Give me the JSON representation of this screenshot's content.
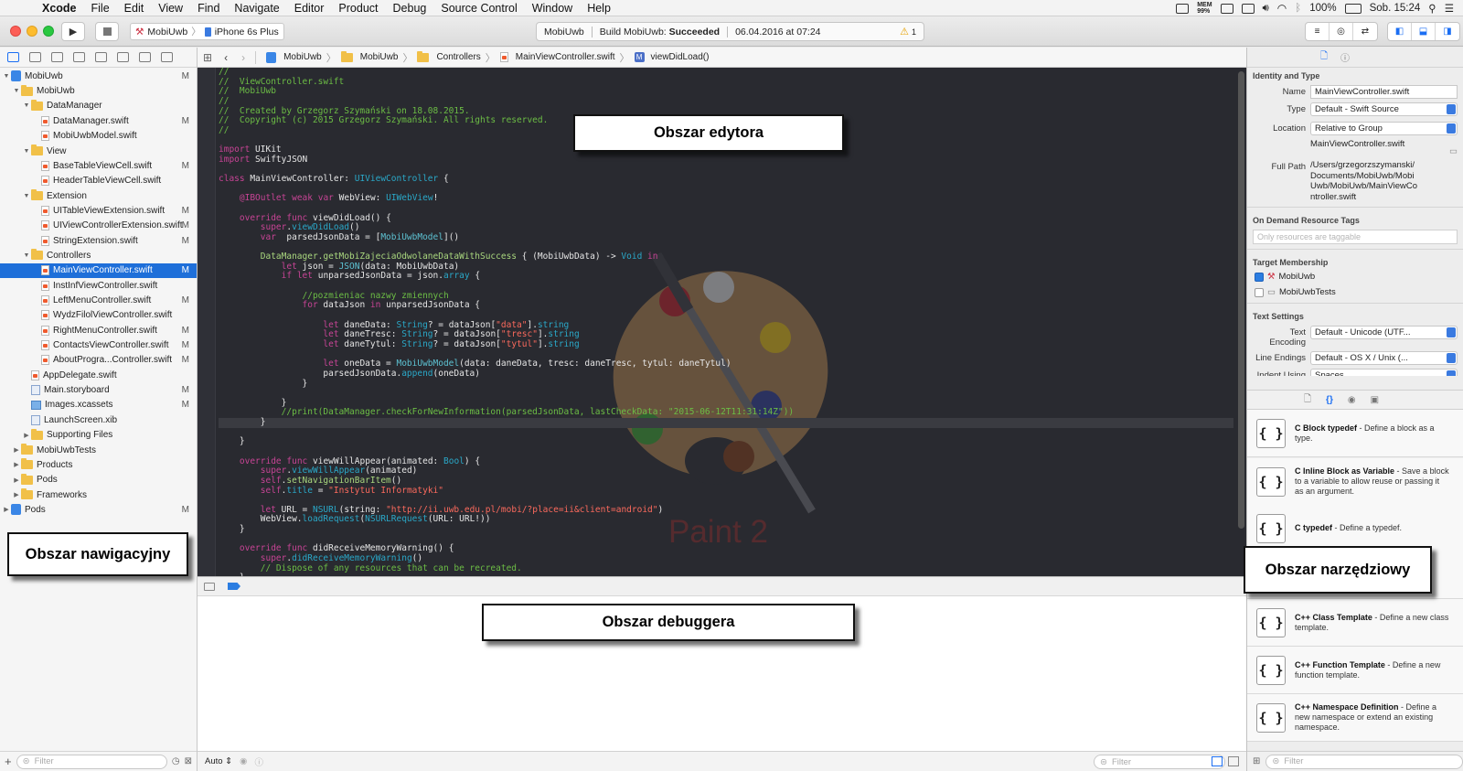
{
  "menubar": {
    "app": "Xcode",
    "items": [
      "File",
      "Edit",
      "View",
      "Find",
      "Navigate",
      "Editor",
      "Product",
      "Debug",
      "Source Control",
      "Window",
      "Help"
    ],
    "status": {
      "mem": "MEM\n99%",
      "battery": "100%",
      "clock": "Sob. 15:24"
    }
  },
  "toolbar": {
    "scheme": "MobiUwb",
    "device": "iPhone 6s Plus",
    "activity": {
      "project": "MobiUwb",
      "build_prefix": "Build MobiUwb: ",
      "build_status": "Succeeded",
      "datetime": "06.04.2016 at 07:24",
      "warnings": "1"
    }
  },
  "navigator": {
    "rows": [
      {
        "label": "MobiUwb",
        "indent": 0,
        "disc": "▼",
        "icon": "proj",
        "mark": "M"
      },
      {
        "label": "MobiUwb",
        "indent": 1,
        "disc": "▼",
        "icon": "fold",
        "mark": ""
      },
      {
        "label": "DataManager",
        "indent": 2,
        "disc": "▼",
        "icon": "fold",
        "mark": ""
      },
      {
        "label": "DataManager.swift",
        "indent": 3,
        "disc": "",
        "icon": "swf",
        "mark": "M"
      },
      {
        "label": "MobiUwbModel.swift",
        "indent": 3,
        "disc": "",
        "icon": "swf",
        "mark": ""
      },
      {
        "label": "View",
        "indent": 2,
        "disc": "▼",
        "icon": "fold",
        "mark": ""
      },
      {
        "label": "BaseTableViewCell.swift",
        "indent": 3,
        "disc": "",
        "icon": "swf",
        "mark": "M"
      },
      {
        "label": "HeaderTableViewCell.swift",
        "indent": 3,
        "disc": "",
        "icon": "swf",
        "mark": ""
      },
      {
        "label": "Extension",
        "indent": 2,
        "disc": "▼",
        "icon": "fold",
        "mark": ""
      },
      {
        "label": "UITableViewExtension.swift",
        "indent": 3,
        "disc": "",
        "icon": "swf",
        "mark": "M"
      },
      {
        "label": "UIViewControllerExtension.swift",
        "indent": 3,
        "disc": "",
        "icon": "swf",
        "mark": "M"
      },
      {
        "label": "StringExtension.swift",
        "indent": 3,
        "disc": "",
        "icon": "swf",
        "mark": "M"
      },
      {
        "label": "Controllers",
        "indent": 2,
        "disc": "▼",
        "icon": "fold",
        "mark": ""
      },
      {
        "label": "MainViewController.swift",
        "indent": 3,
        "disc": "",
        "icon": "swf",
        "mark": "M",
        "selected": true
      },
      {
        "label": "InstInfViewController.swift",
        "indent": 3,
        "disc": "",
        "icon": "swf",
        "mark": ""
      },
      {
        "label": "LeftMenuController.swift",
        "indent": 3,
        "disc": "",
        "icon": "swf",
        "mark": "M"
      },
      {
        "label": "WydzFilolViewController.swift",
        "indent": 3,
        "disc": "",
        "icon": "swf",
        "mark": ""
      },
      {
        "label": "RightMenuController.swift",
        "indent": 3,
        "disc": "",
        "icon": "swf",
        "mark": "M"
      },
      {
        "label": "ContactsViewController.swift",
        "indent": 3,
        "disc": "",
        "icon": "swf",
        "mark": "M"
      },
      {
        "label": "AboutProgra...Controller.swift",
        "indent": 3,
        "disc": "",
        "icon": "swf",
        "mark": "M"
      },
      {
        "label": "AppDelegate.swift",
        "indent": 2,
        "disc": "",
        "icon": "swf",
        "mark": ""
      },
      {
        "label": "Main.storyboard",
        "indent": 2,
        "disc": "",
        "icon": "xib",
        "mark": "M"
      },
      {
        "label": "Images.xcassets",
        "indent": 2,
        "disc": "",
        "icon": "asset",
        "mark": "M"
      },
      {
        "label": "LaunchScreen.xib",
        "indent": 2,
        "disc": "",
        "icon": "xib",
        "mark": ""
      },
      {
        "label": "Supporting Files",
        "indent": 2,
        "disc": "▶",
        "icon": "fold",
        "mark": ""
      },
      {
        "label": "MobiUwbTests",
        "indent": 1,
        "disc": "▶",
        "icon": "fold",
        "mark": ""
      },
      {
        "label": "Products",
        "indent": 1,
        "disc": "▶",
        "icon": "fold",
        "mark": ""
      },
      {
        "label": "Pods",
        "indent": 1,
        "disc": "▶",
        "icon": "fold",
        "mark": ""
      },
      {
        "label": "Frameworks",
        "indent": 1,
        "disc": "▶",
        "icon": "fold",
        "mark": ""
      },
      {
        "label": "Pods",
        "indent": 0,
        "disc": "▶",
        "icon": "proj",
        "mark": "M"
      }
    ],
    "filter_placeholder": "Filter"
  },
  "jumpbar": {
    "crumbs": [
      "MobiUwb",
      "MobiUwb",
      "Controllers",
      "MainViewController.swift",
      "viewDidLoad()"
    ]
  },
  "editor": {
    "lines": [
      [
        [
          "//",
          "cm"
        ]
      ],
      [
        [
          "//  ViewController.swift",
          "cm"
        ]
      ],
      [
        [
          "//  MobiUwb",
          "cm"
        ]
      ],
      [
        [
          "//",
          "cm"
        ]
      ],
      [
        [
          "//  Created by Grzegorz Szymański on 18.08.2015.",
          "cm"
        ]
      ],
      [
        [
          "//  Copyright (c) 2015 Grzegorz Szymański. All rights reserved.",
          "cm"
        ]
      ],
      [
        [
          "//",
          "cm"
        ]
      ],
      [
        [
          "",
          ""
        ]
      ],
      [
        [
          "import",
          "kw"
        ],
        [
          " UIKit",
          ""
        ]
      ],
      [
        [
          "import",
          "kw"
        ],
        [
          " SwiftyJSON",
          ""
        ]
      ],
      [
        [
          "",
          ""
        ]
      ],
      [
        [
          "class",
          "kw"
        ],
        [
          " MainViewController: ",
          ""
        ],
        [
          "UIViewController",
          "ty"
        ],
        [
          " {",
          ""
        ]
      ],
      [
        [
          "",
          ""
        ]
      ],
      [
        [
          "    ",
          ""
        ],
        [
          "@IBOutlet",
          "kw"
        ],
        [
          " ",
          ""
        ],
        [
          "weak",
          "kw"
        ],
        [
          " ",
          ""
        ],
        [
          "var",
          "kw"
        ],
        [
          " WebView: ",
          ""
        ],
        [
          "UIWebView",
          "ty"
        ],
        [
          "!",
          ""
        ]
      ],
      [
        [
          "",
          ""
        ]
      ],
      [
        [
          "    ",
          ""
        ],
        [
          "override",
          "kw"
        ],
        [
          " ",
          ""
        ],
        [
          "func",
          "kw"
        ],
        [
          " viewDidLoad() {",
          ""
        ]
      ],
      [
        [
          "        ",
          ""
        ],
        [
          "super",
          "kw"
        ],
        [
          ".",
          ""
        ],
        [
          "viewDidLoad",
          "ty"
        ],
        [
          "()",
          ""
        ]
      ],
      [
        [
          "        ",
          ""
        ],
        [
          "var",
          "kw"
        ],
        [
          "  parsedJsonData = [",
          ""
        ],
        [
          "MobiUwbModel",
          "tyu"
        ],
        [
          "]()",
          ""
        ]
      ],
      [
        [
          "",
          ""
        ]
      ],
      [
        [
          "        ",
          ""
        ],
        [
          "DataManager.getMobiZajeciaOdwolaneDataWithSuccess",
          "lib"
        ],
        [
          " { (MobiUwbData) -> ",
          ""
        ],
        [
          "Void",
          "ty"
        ],
        [
          " ",
          ""
        ],
        [
          "in",
          "kw"
        ]
      ],
      [
        [
          "            ",
          ""
        ],
        [
          "let",
          "kw"
        ],
        [
          " json = ",
          ""
        ],
        [
          "JSON",
          "tyu"
        ],
        [
          "(data: MobiUwbData)",
          ""
        ]
      ],
      [
        [
          "            ",
          ""
        ],
        [
          "if",
          "kw"
        ],
        [
          " ",
          ""
        ],
        [
          "let",
          "kw"
        ],
        [
          " unparsedJsonData = json.",
          ""
        ],
        [
          "array",
          "ty"
        ],
        [
          " {",
          ""
        ]
      ],
      [
        [
          "",
          ""
        ]
      ],
      [
        [
          "                ",
          ""
        ],
        [
          "//pozmieniac nazwy zmiennych",
          "cm"
        ]
      ],
      [
        [
          "                ",
          ""
        ],
        [
          "for",
          "kw"
        ],
        [
          " dataJson ",
          ""
        ],
        [
          "in",
          "kw"
        ],
        [
          " unparsedJsonData {",
          ""
        ]
      ],
      [
        [
          "",
          ""
        ]
      ],
      [
        [
          "                    ",
          ""
        ],
        [
          "let",
          "kw"
        ],
        [
          " daneData: ",
          ""
        ],
        [
          "String",
          "ty"
        ],
        [
          "? = dataJson[",
          ""
        ],
        [
          "\"data\"",
          "st"
        ],
        [
          "].",
          ""
        ],
        [
          "string",
          "ty"
        ]
      ],
      [
        [
          "                    ",
          ""
        ],
        [
          "let",
          "kw"
        ],
        [
          " daneTresc: ",
          ""
        ],
        [
          "String",
          "ty"
        ],
        [
          "? = dataJson[",
          ""
        ],
        [
          "\"tresc\"",
          "st"
        ],
        [
          "].",
          ""
        ],
        [
          "string",
          "ty"
        ]
      ],
      [
        [
          "                    ",
          ""
        ],
        [
          "let",
          "kw"
        ],
        [
          " daneTytul: ",
          ""
        ],
        [
          "String",
          "ty"
        ],
        [
          "? = dataJson[",
          ""
        ],
        [
          "\"tytul\"",
          "st"
        ],
        [
          "].",
          ""
        ],
        [
          "string",
          "ty"
        ]
      ],
      [
        [
          "",
          ""
        ]
      ],
      [
        [
          "                    ",
          ""
        ],
        [
          "let",
          "kw"
        ],
        [
          " oneData = ",
          ""
        ],
        [
          "MobiUwbModel",
          "tyu"
        ],
        [
          "(data: daneData, tresc: daneTresc, tytul: daneTytul)",
          ""
        ]
      ],
      [
        [
          "                    parsedJsonData.",
          ""
        ],
        [
          "append",
          "ty"
        ],
        [
          "(oneData)",
          ""
        ]
      ],
      [
        [
          "                }",
          ""
        ]
      ],
      [
        [
          "",
          ""
        ]
      ],
      [
        [
          "            }",
          ""
        ]
      ],
      [
        [
          "            ",
          ""
        ],
        [
          "//print(DataManager.checkForNewInformation(parsedJsonData, lastCheckData: \"2015-06-12T11:31:14Z\"))",
          "cm"
        ]
      ],
      [
        [
          "        }",
          ""
        ]
      ],
      [
        [
          "",
          ""
        ]
      ],
      [
        [
          "    }",
          ""
        ]
      ],
      [
        [
          "",
          ""
        ]
      ],
      [
        [
          "    ",
          ""
        ],
        [
          "override",
          "kw"
        ],
        [
          " ",
          ""
        ],
        [
          "func",
          "kw"
        ],
        [
          " viewWillAppear(animated: ",
          ""
        ],
        [
          "Bool",
          "ty"
        ],
        [
          ") {",
          ""
        ]
      ],
      [
        [
          "        ",
          ""
        ],
        [
          "super",
          "kw"
        ],
        [
          ".",
          ""
        ],
        [
          "viewWillAppear",
          "ty"
        ],
        [
          "(animated)",
          ""
        ]
      ],
      [
        [
          "        ",
          ""
        ],
        [
          "self",
          "kw"
        ],
        [
          ".",
          ""
        ],
        [
          "setNavigationBarItem",
          "lib"
        ],
        [
          "()",
          ""
        ]
      ],
      [
        [
          "        ",
          ""
        ],
        [
          "self",
          "kw"
        ],
        [
          ".",
          ""
        ],
        [
          "title",
          "ty"
        ],
        [
          " = ",
          ""
        ],
        [
          "\"Instytut Informatyki\"",
          "st"
        ]
      ],
      [
        [
          "",
          ""
        ]
      ],
      [
        [
          "        ",
          ""
        ],
        [
          "let",
          "kw"
        ],
        [
          " URL = ",
          ""
        ],
        [
          "NSURL",
          "ty"
        ],
        [
          "(string: ",
          ""
        ],
        [
          "\"http://ii.uwb.edu.pl/mobi/?place=ii&client=android\"",
          "st"
        ],
        [
          ")",
          ""
        ]
      ],
      [
        [
          "        WebView.",
          ""
        ],
        [
          "loadRequest",
          "ty"
        ],
        [
          "(",
          ""
        ],
        [
          "NSURLRequest",
          "ty"
        ],
        [
          "(URL: URL!))",
          ""
        ]
      ],
      [
        [
          "    }",
          ""
        ]
      ],
      [
        [
          "",
          ""
        ]
      ],
      [
        [
          "    ",
          ""
        ],
        [
          "override",
          "kw"
        ],
        [
          " ",
          ""
        ],
        [
          "func",
          "kw"
        ],
        [
          " didReceiveMemoryWarning() {",
          ""
        ]
      ],
      [
        [
          "        ",
          ""
        ],
        [
          "super",
          "kw"
        ],
        [
          ".",
          ""
        ],
        [
          "didReceiveMemoryWarning",
          "ty"
        ],
        [
          "()",
          ""
        ]
      ],
      [
        [
          "        ",
          ""
        ],
        [
          "// Dispose of any resources that can be recreated.",
          "cm"
        ]
      ],
      [
        [
          "    }",
          ""
        ]
      ]
    ],
    "highlight_line": 36,
    "watermark": "Paint 2"
  },
  "debug": {
    "footer_mode": "Auto",
    "filter_placeholder": "Filter"
  },
  "inspector": {
    "identity_title": "Identity and Type",
    "name_label": "Name",
    "name_value": "MainViewController.swift",
    "type_label": "Type",
    "type_value": "Default - Swift Source",
    "location_label": "Location",
    "location_value": "Relative to Group",
    "location_file": "MainViewController.swift",
    "fullpath_label": "Full Path",
    "fullpath_value": "/Users/grzegorzszymanski/Documents/MobiUwb/MobiUwb/MobiUwb/MainViewController.swift",
    "ondemand_title": "On Demand Resource Tags",
    "ondemand_placeholder": "Only resources are taggable",
    "target_title": "Target Membership",
    "targets": [
      {
        "name": "MobiUwb",
        "checked": true
      },
      {
        "name": "MobiUwbTests",
        "checked": false
      }
    ],
    "text_title": "Text Settings",
    "encoding_label": "Text Encoding",
    "encoding_value": "Default - Unicode (UTF...",
    "endings_label": "Line Endings",
    "endings_value": "Default - OS X / Unix (...",
    "indent_label": "Indent Using",
    "indent_value": "Spaces"
  },
  "library": {
    "items": [
      {
        "title": "C Block typedef",
        "text": " - Define a block as a type."
      },
      {
        "title": "C Inline Block as Variable",
        "text": " - Save a block to a variable to allow reuse or passing it as an argument."
      },
      {
        "title": "C typedef",
        "text": " - Define a typedef."
      },
      {
        "title": "",
        "text": ""
      },
      {
        "title": "C++ Class Template",
        "text": " - Define a new class template."
      },
      {
        "title": "C++ Function Template",
        "text": " - Define a new function template."
      },
      {
        "title": "C++ Namespace Definition",
        "text": " - Define a new namespace or extend an existing namespace."
      }
    ],
    "filter_placeholder": "Filter"
  },
  "callouts": {
    "editor": "Obszar edytora",
    "navigator": "Obszar nawigacyjny",
    "utilities": "Obszar narzędziowy",
    "debugger": "Obszar debuggera"
  },
  "colors": {
    "selection": "#1e6fd9",
    "editor_bg": "#292a30",
    "comment": "#6cbd45",
    "keyword": "#c74495",
    "type": "#2aa8c8",
    "string": "#fc6a5d"
  }
}
